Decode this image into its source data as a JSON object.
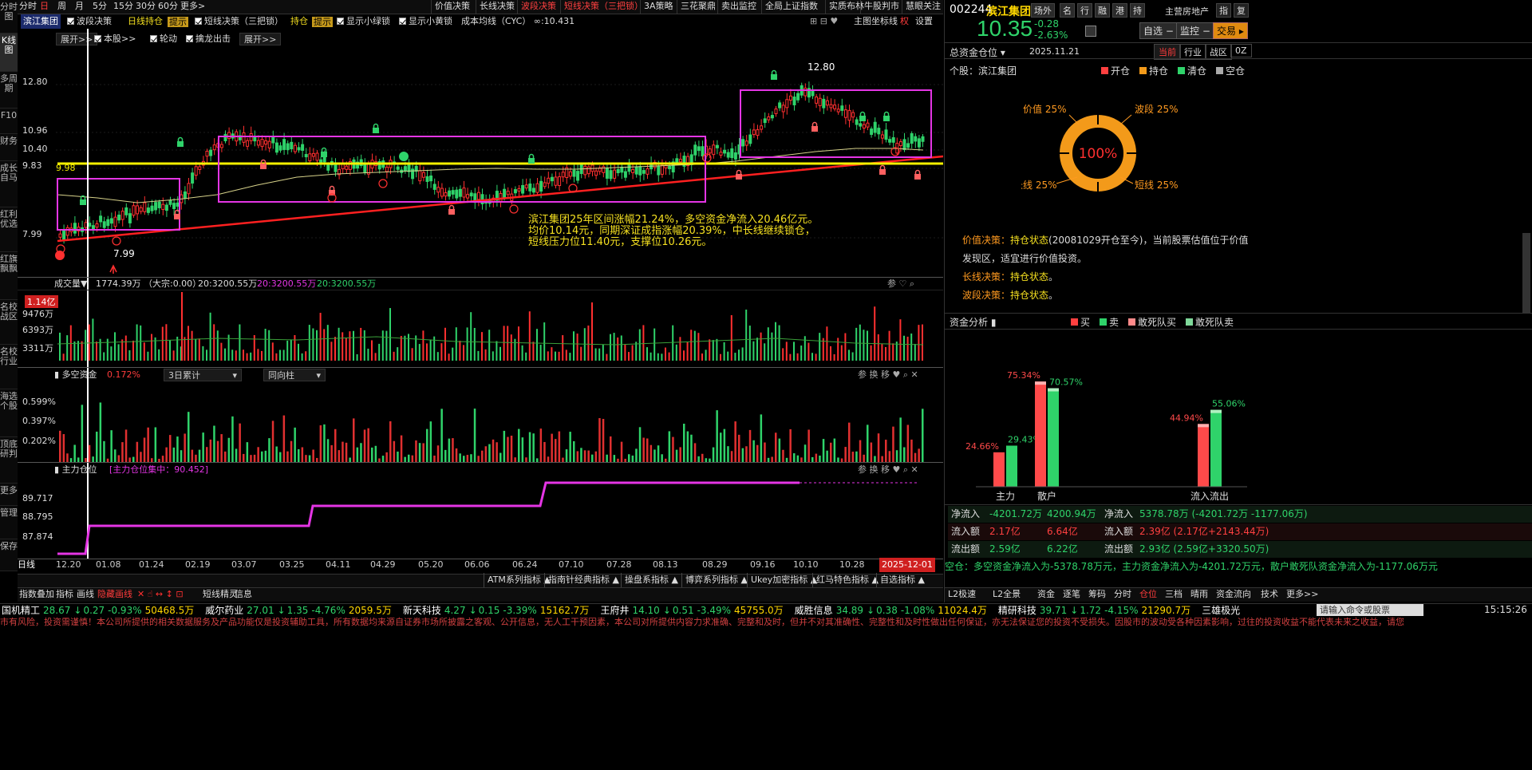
{
  "left_tabs": [
    "分时图",
    "K线图",
    "多周期",
    "F10",
    "财务",
    "成长自马",
    "红利优选",
    "红旗飘飘",
    "名校战区",
    "名校行业",
    "海选个股",
    "顶底研判",
    "更多",
    "管理",
    "保存"
  ],
  "period_tabs": [
    "分时",
    "日",
    "周",
    "月",
    "5分",
    "15分",
    "30分",
    "60分",
    "更多>"
  ],
  "strategy_tabs": [
    "价值决策",
    "长线决策",
    "波段决策",
    "短线决策（三把锁）",
    "3A策略",
    "三花聚鼎",
    "卖出监控",
    "全局上证指数",
    "实质布林",
    "牛股判市",
    "慧眼关注"
  ],
  "chart_header": {
    "stock": "滨江集团",
    "band": "波段决策",
    "dayline": "日线持仓",
    "tip": "提示",
    "short": "短线决策（三把锁）",
    "hold": "持仓",
    "tip2": "提示",
    "green_lock": "显示小绿锁",
    "yellow_lock": "显示小黄锁",
    "cost": "成本均线（CYC） ∞:10.431"
  },
  "chart_header_right": {
    "main": "主图",
    "coord": "坐标线",
    "quan": "权",
    "settings": "设置"
  },
  "sub_header": {
    "expand1": "展开>>",
    "benchmark": "本股>>",
    "rotate": "轮动",
    "dragon": "擒龙出击",
    "expand2": "展开>>"
  },
  "price_axis": [
    "12.80",
    "10.96",
    "10.40",
    "9.83",
    "7.99"
  ],
  "annot": {
    "high": "12.80",
    "low": "7.99",
    "yline": "9.98"
  },
  "note": [
    "滨江集团25年区间涨幅21.24%，多空资金净流入20.46亿元。",
    "均价10.14元，同期深证成指涨幅20.39%，中长线继续锁仓，",
    "短线压力位11.40元，支撑位10.26元。"
  ],
  "vol": {
    "title": "成交量▼",
    "value": "1774.39万 （大宗:0.00）",
    "ma1": "20:3200.55万",
    "ma2": "20:3200.55万",
    "ma3": "20:3200.55万",
    "axis": [
      "1.14亿",
      "9476万",
      "6393万",
      "3311万"
    ]
  },
  "ls": {
    "title": "多空资金",
    "value": "0.172%",
    "sel1": "3日累计",
    "sel2": "同向柱",
    "axis": [
      "0.599%",
      "0.397%",
      "0.202%"
    ]
  },
  "zl": {
    "title": "主力仓位",
    "value": "[主力仓位集中：90.452]",
    "axis": [
      "89.717",
      "88.795",
      "87.874"
    ]
  },
  "dates": [
    "12.20",
    "01.08",
    "01.24",
    "02.19",
    "03.07",
    "03.25",
    "04.11",
    "04.29",
    "05.20",
    "06.06",
    "06.24",
    "07.10",
    "07.28",
    "08.13",
    "08.29",
    "09.16",
    "10.10",
    "10.28"
  ],
  "date_end": "2025-12-01",
  "day_label": "日线",
  "indicator_bar": [
    "ATM系列指标",
    "指南针经典指标",
    "操盘系指标",
    "博弈系列指标",
    "Ukey加密指标",
    "红马特色指标",
    "自选指标"
  ],
  "tool_bar": [
    "指数叠加",
    "指标",
    "画线",
    "隐藏画线",
    "短线精灵",
    "信息"
  ],
  "quote": {
    "code": "002244",
    "name": "滨江集团",
    "tags": [
      "场外",
      "名",
      "行",
      "融",
      "港",
      "持"
    ],
    "industry": "主营房地产",
    "ind_btns": [
      "指",
      "复"
    ],
    "price": "10.35",
    "chg": "-0.28",
    "pct": "-2.63%",
    "self": "自选",
    "monitor": "监控",
    "trade": "交易"
  },
  "position": {
    "title": "总资金仓位",
    "date": "2025.11.21",
    "tabs": [
      "当前",
      "行业",
      "战区",
      "0Z"
    ],
    "stock_label": "个股：滨江集团",
    "legend": [
      "开仓",
      "持仓",
      "清仓",
      "空仓"
    ],
    "center": "100%",
    "segments": [
      {
        "label": "价值",
        "pct": "25%"
      },
      {
        "label": "波段",
        "pct": "25%"
      },
      {
        "label": "长线",
        "pct": "25%"
      },
      {
        "label": "短线",
        "pct": "25%"
      }
    ]
  },
  "decision": [
    {
      "k": "价值决策：",
      "v": "持仓状态",
      "t": "(20081029开仓至今)，当前股票估值位于价值发现区，适宜进行价值投资。"
    },
    {
      "k": "长线决策：",
      "v": "持仓状态",
      "t": "。"
    },
    {
      "k": "波段决策：",
      "v": "持仓状态",
      "t": "。"
    }
  ],
  "fund": {
    "title": "资金分析",
    "legend": [
      "买",
      "卖",
      "敢死队买",
      "敢死队卖"
    ],
    "bars": [
      {
        "label": "主力",
        "buy": "24.66%",
        "sell": "29.43%"
      },
      {
        "label": "散户",
        "buy": "75.34%",
        "sell": "70.57%"
      },
      {
        "label": "流入流出",
        "buy": "44.94%",
        "sell": "55.06%"
      }
    ]
  },
  "flow_rows": [
    {
      "a": "净流入",
      "b": "-4201.72万",
      "c": "4200.94万",
      "d": "净流入",
      "e": "5378.78万 (-4201.72万 -1177.06万)"
    },
    {
      "a": "流入额",
      "b": "2.17亿",
      "c": "6.64亿",
      "d": "流入额",
      "e": "2.39亿 (2.17亿+2143.44万)"
    },
    {
      "a": "流出额",
      "b": "2.59亿",
      "c": "6.22亿",
      "d": "流出额",
      "e": "2.93亿 (2.59亿+3320.50万)"
    }
  ],
  "summary": "空仓：多空资金净流入为-5378.78万元，主力资金净流入为-4201.72万元，散户敢死队资金净流入为-1177.06万元",
  "right_tabs": [
    "L2极速",
    "L2全景",
    "资金",
    "逐笔",
    "筹码",
    "分时",
    "仓位",
    "三档",
    "晴雨",
    "资金流向",
    "技术",
    "更多>>"
  ],
  "ticker": [
    {
      "n": "国机精工",
      "v": "28.67",
      "c": "0.27",
      "p": "-0.93%",
      "a": "50468.5万"
    },
    {
      "n": "威尔药业",
      "v": "27.01",
      "c": "1.35",
      "p": "-4.76%",
      "a": "2059.5万"
    },
    {
      "n": "新天科技",
      "v": "4.27",
      "c": "0.15",
      "p": "-3.39%",
      "a": "15162.7万"
    },
    {
      "n": "王府井",
      "v": "14.10",
      "c": "0.51",
      "p": "-3.49%",
      "a": "45755.0万"
    },
    {
      "n": "威胜信息",
      "v": "34.89",
      "c": "0.38",
      "p": "-1.08%",
      "a": "11024.4万"
    },
    {
      "n": "精研科技",
      "v": "39.71",
      "c": "1.72",
      "p": "-4.15%",
      "a": "21290.7万"
    },
    {
      "n": "三雄极光",
      "v": "",
      "c": "",
      "p": "",
      "a": ""
    }
  ],
  "cmd_placeholder": "请输入命令或股票",
  "clock": "15:15:26",
  "disclaimer": "市有风险，投资需谨慎！本公司所提供的相关数据服务及产品功能仅是投资辅助工具，所有数据均来源自证券市场所披露之客观、公开信息，无人工干预因素，本公司对所提供内容力求准确、完整和及时，但并不对其准确性、完整性和及时性做出任何保证，亦无法保证您的投资不受损失。因股市的波动受各种因素影响，过往的投资收益不能代表未来之收益，请您"
}
